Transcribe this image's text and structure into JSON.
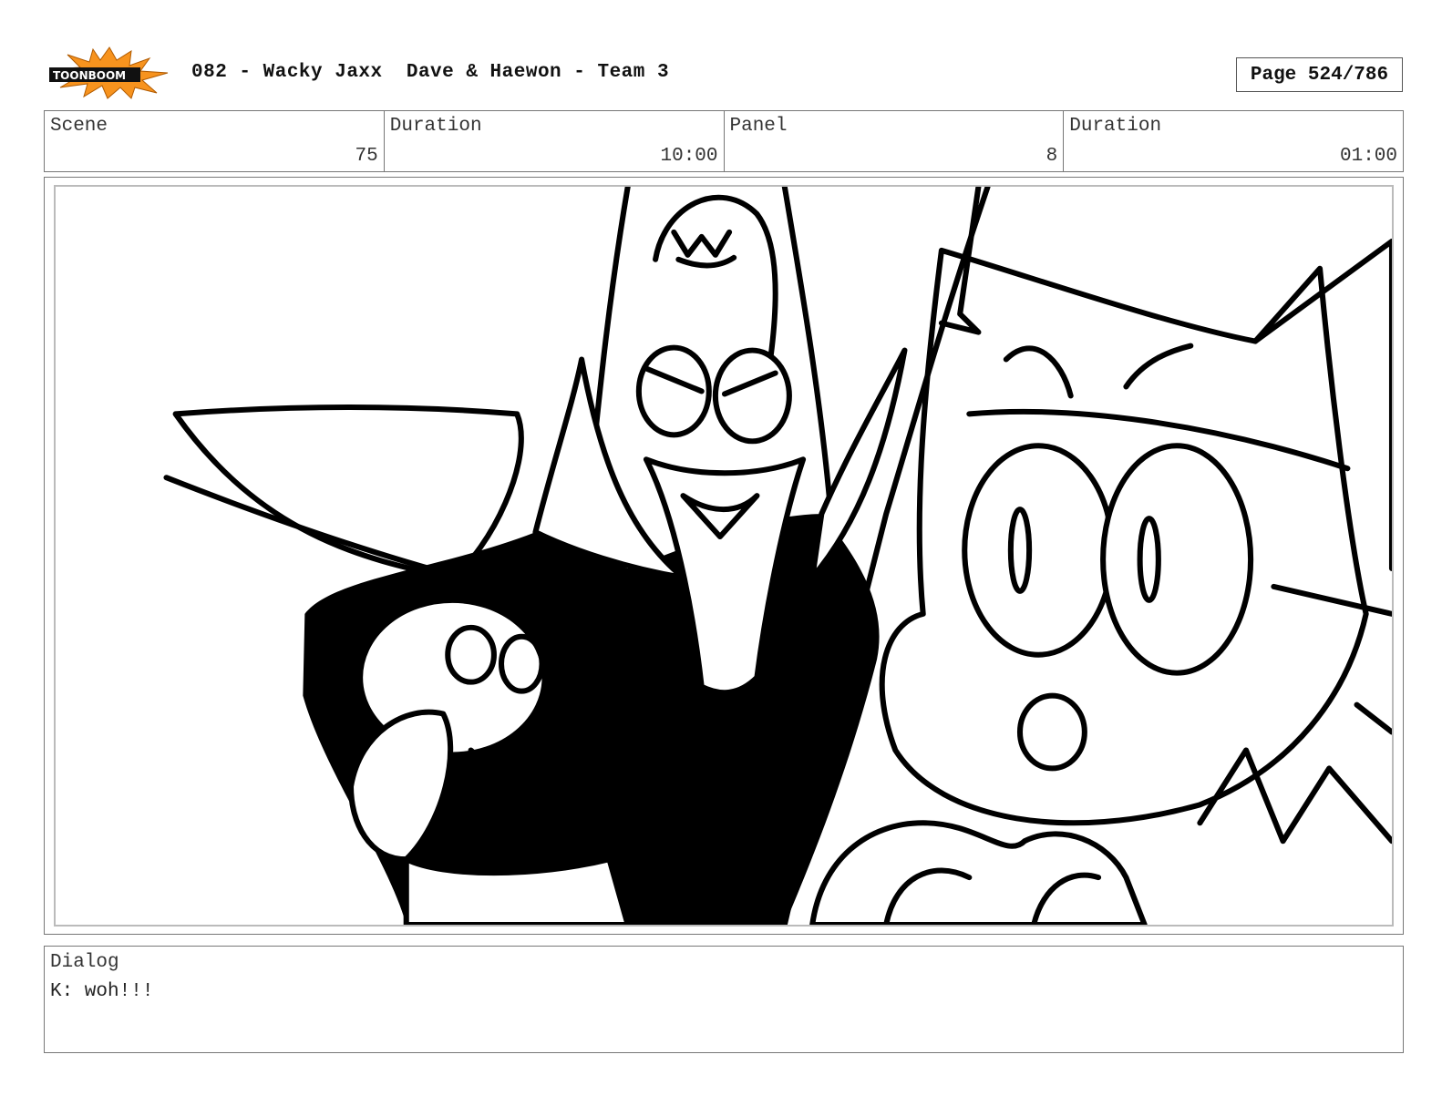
{
  "header": {
    "logo_text": "TOONBOOM",
    "title": "082 - Wacky Jaxx  Dave & Haewon - Team 3",
    "page": "Page 524/786"
  },
  "info": {
    "scene_label": "Scene",
    "scene_value": "75",
    "scene_duration_label": "Duration",
    "scene_duration_value": "10:00",
    "panel_label": "Panel",
    "panel_value": "8",
    "panel_duration_label": "Duration",
    "panel_duration_value": "01:00"
  },
  "dialog": {
    "label": "Dialog",
    "text": "K: woh!!!"
  },
  "colors": {
    "logo_burst": "#f7931e",
    "ink": "#000000",
    "frame_border": "#777777"
  }
}
